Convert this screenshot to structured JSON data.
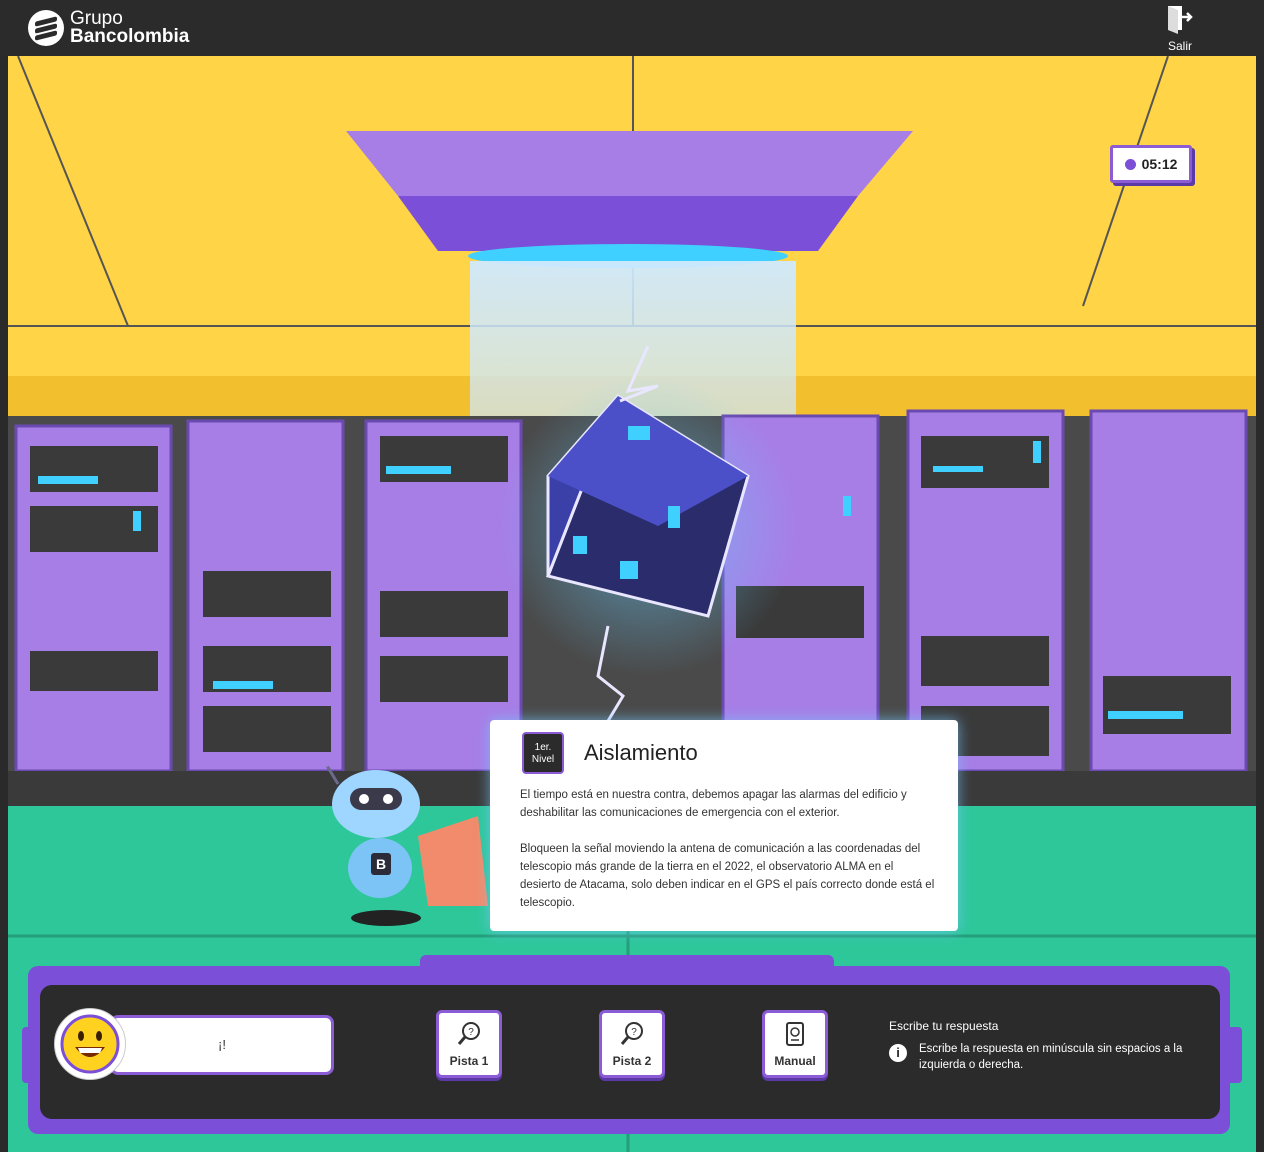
{
  "header": {
    "brand_line1": "Grupo",
    "brand_line2": "Bancolombia",
    "exit_label": "Salir"
  },
  "timer": {
    "value": "05:12"
  },
  "challenge": {
    "level_badge_line1": "1er.",
    "level_badge_line2": "Nivel",
    "title": "Aislamiento",
    "paragraph1": "El tiempo está en nuestra contra, debemos apagar las alarmas del edificio y deshabilitar las comunicaciones de emergencia con el exterior.",
    "paragraph2": "Bloqueen la señal moviendo la antena de comunicación a las coordenadas del telescopio más grande de la tierra en el 2022, el observatorio ALMA en el desierto de Atacama, solo deben indicar en el GPS el país correcto donde está el telescopio."
  },
  "robot": {
    "chest_letter": "B"
  },
  "bottom_bar": {
    "answer_display": "¡!",
    "tools": [
      {
        "label": "Pista 1",
        "icon": "magnifier-question-icon"
      },
      {
        "label": "Pista 2",
        "icon": "magnifier-question-icon"
      },
      {
        "label": "Manual",
        "icon": "manual-book-icon"
      }
    ],
    "help_title": "Escribe tu respuesta",
    "help_text": "Escribe la respuesta en minúscula sin espacios a la izquierda o derecha."
  },
  "colors": {
    "ceiling": "#ffd447",
    "accent_purple": "#7c4fd8",
    "floor_green": "#2ec79a",
    "server_purple": "#a77ee6",
    "dark_panel": "#2b2b2b",
    "glow_cyan": "#3fd0ff"
  }
}
